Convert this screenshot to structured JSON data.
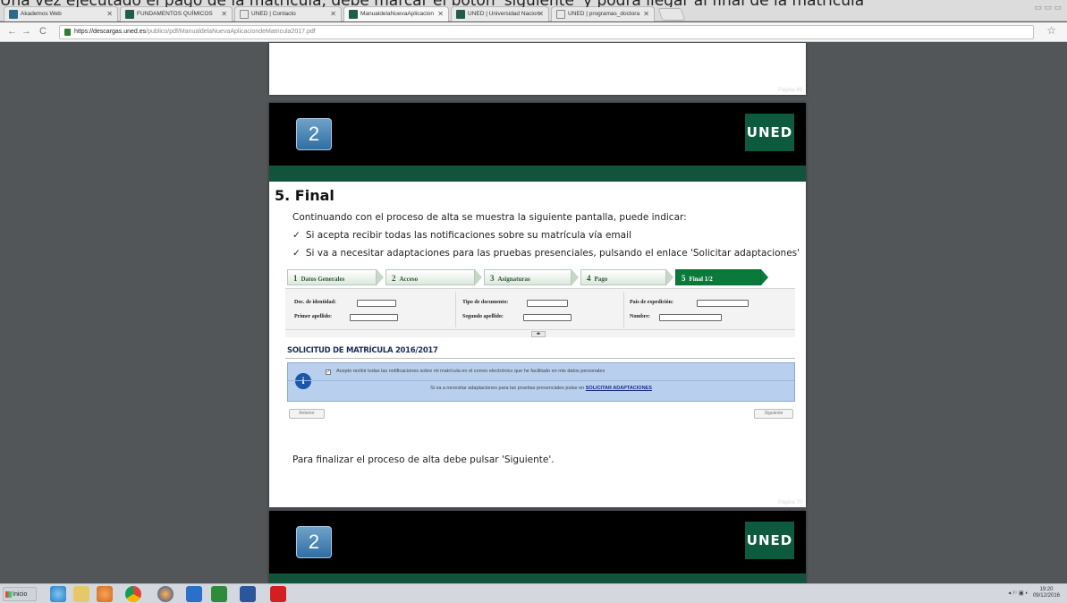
{
  "caption": "Una vez ejecutado el pago de la matrícula, debe marcar el botón 'siguiente' y podrá llegar al final de la matrícula",
  "browser": {
    "tabs": [
      {
        "label": "Akademos Web",
        "icon": "akademos-icon"
      },
      {
        "label": "FUNDAMENTOS QUÍMICOS",
        "icon": "uned-icon"
      },
      {
        "label": "UNED | Contacto",
        "icon": "document-icon"
      },
      {
        "label": "ManualdelaNuevaAplicacion",
        "icon": "uned-icon",
        "active": true
      },
      {
        "label": "UNED | Universidad Nacion",
        "icon": "uned-icon"
      },
      {
        "label": "UNED | programas_doctora",
        "icon": "document-icon"
      }
    ],
    "url_host": "https://descargas.uned.es",
    "url_path": "/publico/pdf/ManualdelaNuevaAplicaciondeMatricula2017.pdf"
  },
  "pdf": {
    "prev_page_number": "Página 69",
    "page_number": "Página 70",
    "banner_number": "2",
    "banner_logo": "UNED",
    "section_title": "5. Final",
    "intro": "Continuando con el proceso de alta se muestra la siguiente pantalla, puede indicar:",
    "bullets": [
      "Si acepta recibir todas las notificaciones sobre su matrícula vía email",
      "Si va a necesitar adaptaciones para las pruebas presenciales, pulsando el enlace 'Solicitar adaptaciones'"
    ],
    "steps": [
      {
        "num": "1",
        "label": "Datos Generales"
      },
      {
        "num": "2",
        "label": "Acceso"
      },
      {
        "num": "3",
        "label": "Asignaturas"
      },
      {
        "num": "4",
        "label": "Pago"
      },
      {
        "num": "5",
        "label": "Final 1/2",
        "active": true
      }
    ],
    "form": {
      "doc_identidad": "Doc. de identidad:",
      "tipo_documento": "Tipo de documento:",
      "pais_expedicion": "País de expedición:",
      "primer_apellido": "Primer apellido:",
      "segundo_apellido": "Segundo apellido:",
      "nombre": "Nombre:"
    },
    "solicitud_title": "SOLICITUD DE MATRÍCULA 2016/2017",
    "info_check_text": "Acepto recibir todas las notificaciones sobre mi matrícula en el correo electrónico que he facilitado en mis datos personales",
    "info_adapt_text": "Si va a necesitar adaptaciones para las pruebas presenciales pulse en",
    "info_adapt_link": "SOLICITAR ADAPTACIONES",
    "btn_prev": "Anterior",
    "btn_next": "Siguiente",
    "final_text": "Para finalizar el proceso de alta debe pulsar 'Siguiente'."
  },
  "taskbar": {
    "start_label": "Inicio",
    "time": "19:20",
    "date": "09/12/2016"
  }
}
